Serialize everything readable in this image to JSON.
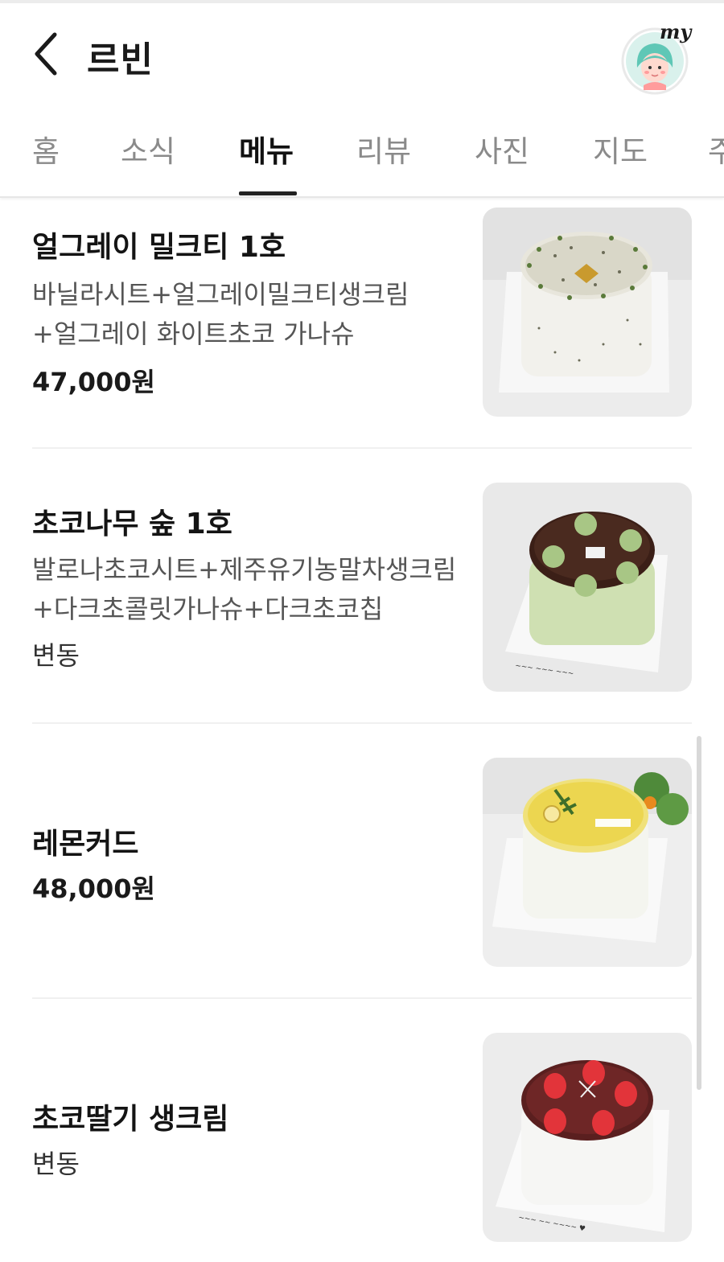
{
  "header": {
    "title": "르빈",
    "my_label": "my"
  },
  "tabs": [
    {
      "label": "홈"
    },
    {
      "label": "소식"
    },
    {
      "label": "메뉴"
    },
    {
      "label": "리뷰"
    },
    {
      "label": "사진"
    },
    {
      "label": "지도"
    },
    {
      "label": "주"
    }
  ],
  "active_tab": "메뉴",
  "menu": [
    {
      "name": "얼그레이 밀크티 1호",
      "desc": "바닐라시트+얼그레이밀크티생크림 +얼그레이 화이트초코 가나슈",
      "price": "47,000원"
    },
    {
      "name": "초코나무 숲 1호",
      "desc": "발로나초코시트+제주유기농말차생크림+다크초콜릿가나슈+다크초코칩",
      "price": "변동"
    },
    {
      "name": "레몬커드",
      "desc": "",
      "price": "48,000원"
    },
    {
      "name": "초코딸기 생크림",
      "desc": "",
      "price": "변동"
    }
  ],
  "colors": {
    "accent_text": "#111111",
    "muted_text": "#8a8a8a",
    "avatar_bg": "#d9f1ec",
    "avatar_hair": "#5fc7b6"
  }
}
